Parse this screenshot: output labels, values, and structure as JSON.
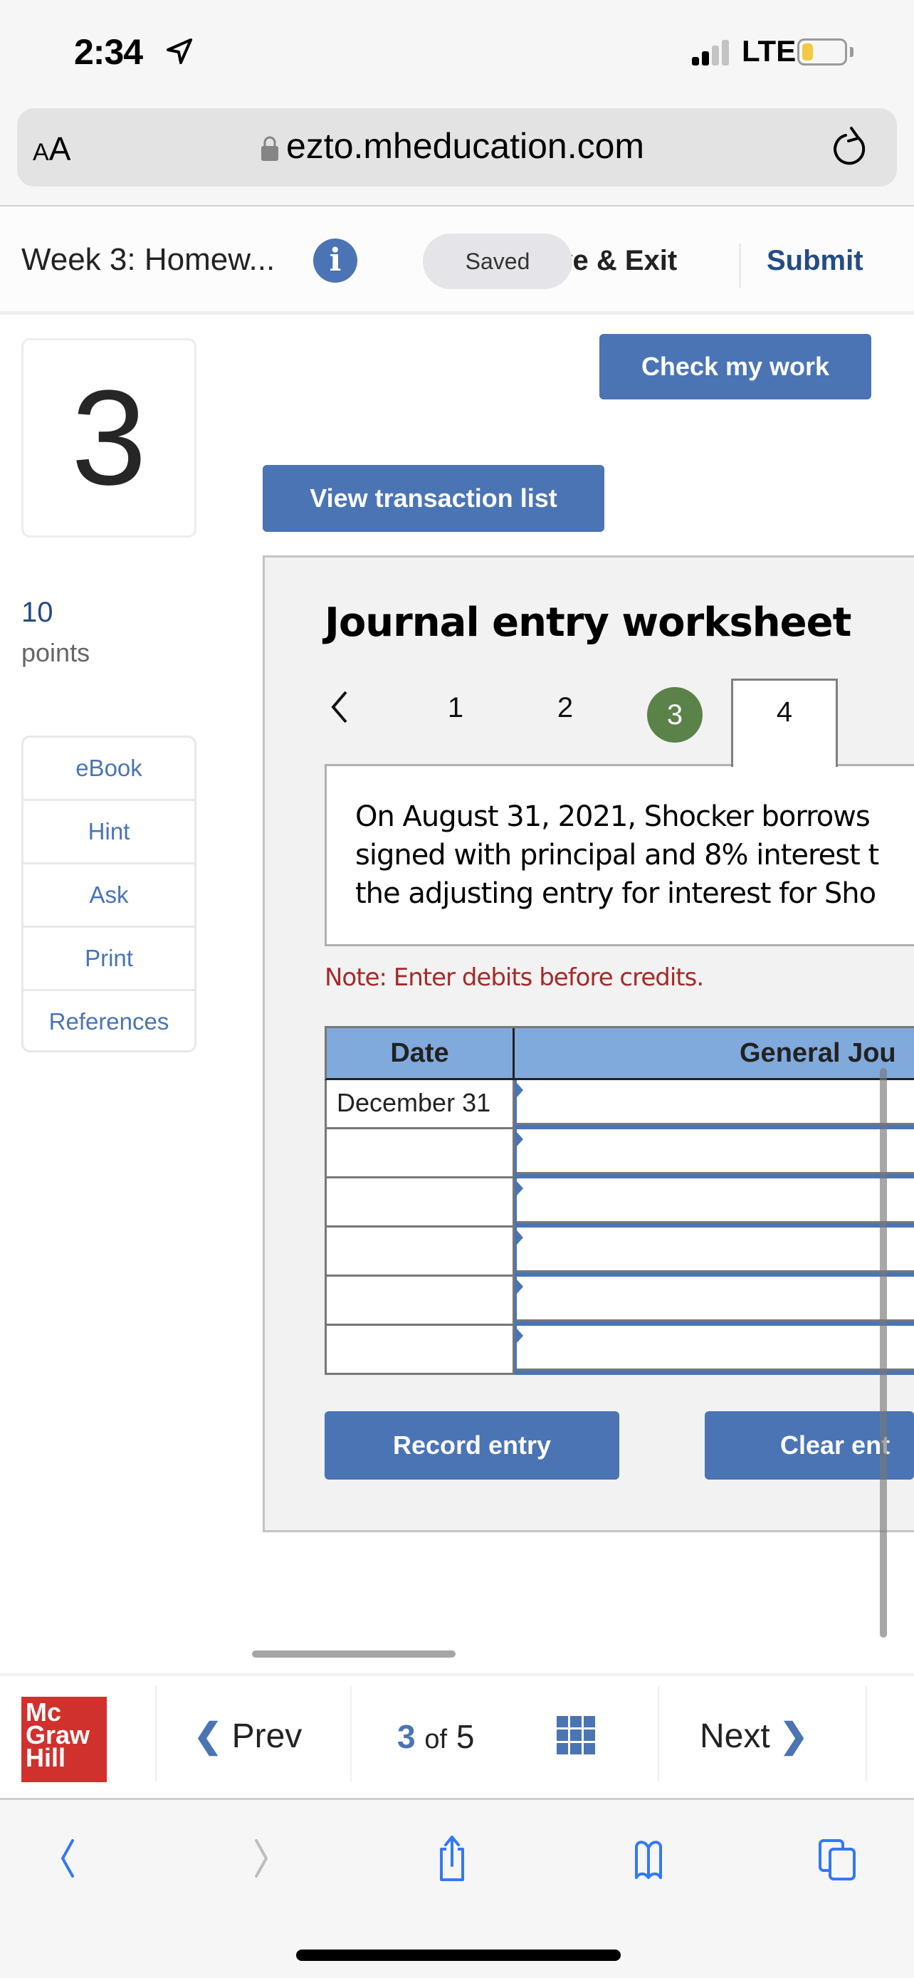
{
  "status_bar": {
    "time": "2:34",
    "network": "LTE",
    "signal_bars_active": 2,
    "signal_bars_total": 4,
    "battery_level": 0.25,
    "battery_color": "#f5c842"
  },
  "browser": {
    "text_size_label_small": "A",
    "text_size_label_large": "A",
    "url": "ezto.mheducation.com",
    "icons": [
      "location-arrow-icon",
      "lock-icon",
      "reload-icon"
    ]
  },
  "header": {
    "assignment_title": "Week 3: Homew...",
    "info_icon_glyph": "i",
    "saved_label": "Saved",
    "save_exit_label": "ave & Exit",
    "submit_label": "Submit"
  },
  "question": {
    "number": "3",
    "points_value": "10",
    "points_label": "points"
  },
  "tools": [
    {
      "label": "eBook"
    },
    {
      "label": "Hint"
    },
    {
      "label": "Ask"
    },
    {
      "label": "Print"
    },
    {
      "label": "References"
    }
  ],
  "actions": {
    "check_my_work": "Check my work",
    "view_transaction_list": "View transaction list"
  },
  "worksheet": {
    "title": "Journal entry worksheet",
    "prev_glyph": "<",
    "steps": [
      "1",
      "2",
      "3",
      "4"
    ],
    "completed_step": "3",
    "active_step": "4",
    "problem_text": "On August 31, 2021, Shocker borrows\nsigned with principal and 8% interest t\nthe adjusting entry for interest for Sho",
    "note": "Note: Enter debits before credits.",
    "table": {
      "headers": [
        "Date",
        "General Jou"
      ],
      "rows": [
        {
          "date": "December 31",
          "account": ""
        },
        {
          "date": "",
          "account": ""
        },
        {
          "date": "",
          "account": ""
        },
        {
          "date": "",
          "account": ""
        },
        {
          "date": "",
          "account": ""
        },
        {
          "date": "",
          "account": ""
        }
      ]
    },
    "record_entry_label": "Record entry",
    "clear_entry_label": "Clear ent"
  },
  "bottom_nav": {
    "logo_lines": [
      "Mc",
      "Graw",
      "Hill"
    ],
    "prev_label": "Prev",
    "prev_glyph": "❮",
    "current_page": "3",
    "of_label": "of",
    "total_pages": "5",
    "next_label": "Next",
    "next_glyph": "❯"
  },
  "safari_toolbar": {
    "icons": [
      "back-icon",
      "forward-icon",
      "share-icon",
      "bookmarks-icon",
      "tabs-icon"
    ]
  },
  "colors": {
    "accent_blue": "#4a74b4",
    "submit_blue": "#234b86",
    "step_complete_green": "#5a8249",
    "table_header_blue": "#80a9dc",
    "note_red": "#a52a2a",
    "logo_red": "#d0312d"
  }
}
